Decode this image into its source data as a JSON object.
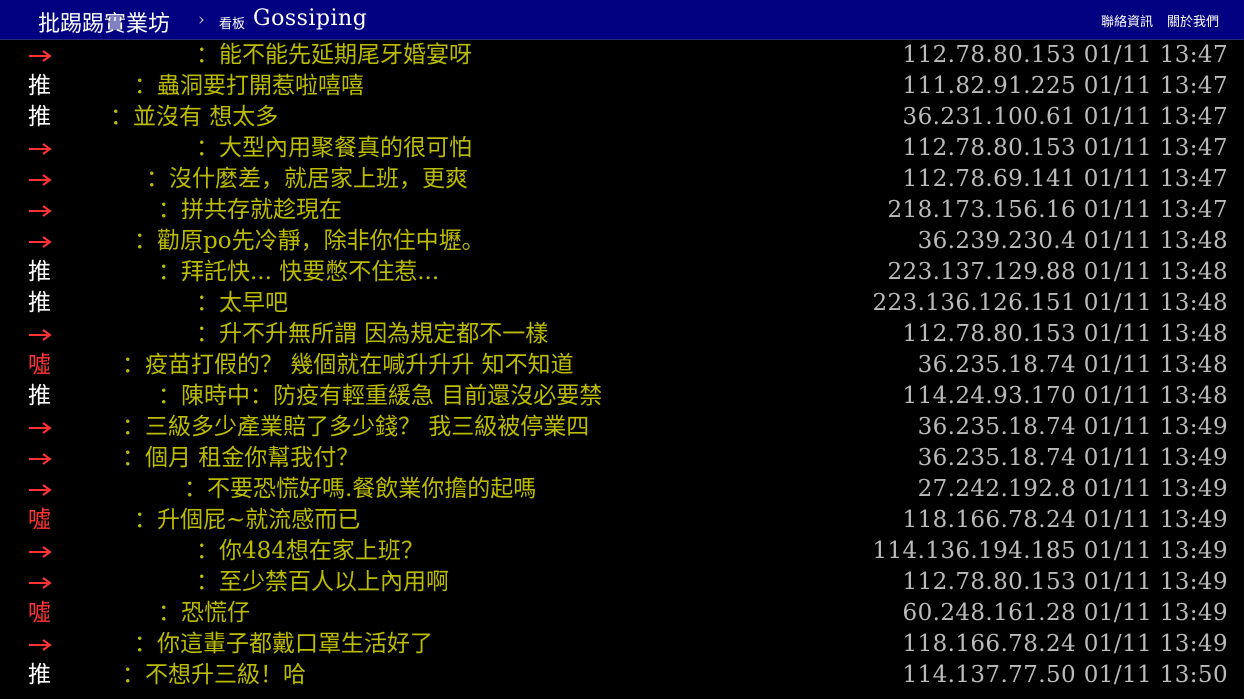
{
  "topbar": {
    "site_title": "批踢踢實業坊",
    "separator": "›",
    "board_label": "看板",
    "board_name": "Gossiping",
    "contact": "聯絡資訊",
    "about": "關於我們"
  },
  "pushes": [
    {
      "tag": "→",
      "type": "arrow",
      "content": "：能不能先延期尾牙婚宴呀",
      "ipdatetime": "112.78.80.153 01/11 13:47"
    },
    {
      "tag": "推",
      "type": "push",
      "content": "：蟲洞要打開惹啦嘻嘻",
      "ipdatetime": "111.82.91.225 01/11 13:47"
    },
    {
      "tag": "推",
      "type": "push",
      "content": "：並沒有 想太多",
      "ipdatetime": "36.231.100.61 01/11 13:47"
    },
    {
      "tag": "→",
      "type": "arrow",
      "content": "：大型內用聚餐真的很可怕",
      "ipdatetime": "112.78.80.153 01/11 13:47"
    },
    {
      "tag": "→",
      "type": "arrow",
      "content": "：沒什麼差，就居家上班，更爽",
      "ipdatetime": "112.78.69.141 01/11 13:47"
    },
    {
      "tag": "→",
      "type": "arrow",
      "content": "：拼共存就趁現在",
      "ipdatetime": "218.173.156.16 01/11 13:47"
    },
    {
      "tag": "→",
      "type": "arrow",
      "content": "：勸原po先冷靜，除非你住中壢。",
      "ipdatetime": "36.239.230.4 01/11 13:48"
    },
    {
      "tag": "推",
      "type": "push",
      "content": "：拜託快... 快要憋不住惹...",
      "ipdatetime": "223.137.129.88 01/11 13:48"
    },
    {
      "tag": "推",
      "type": "push",
      "content": "：太早吧",
      "ipdatetime": "223.136.126.151 01/11 13:48"
    },
    {
      "tag": "→",
      "type": "arrow",
      "content": "：升不升無所謂 因為規定都不一樣",
      "ipdatetime": "112.78.80.153 01/11 13:48"
    },
    {
      "tag": "噓",
      "type": "boo",
      "content": "：疫苗打假的？ 幾個就在喊升升升 知不知道",
      "ipdatetime": "36.235.18.74 01/11 13:48"
    },
    {
      "tag": "推",
      "type": "push",
      "content": "：陳時中：防疫有輕重緩急 目前還沒必要禁",
      "ipdatetime": "114.24.93.170 01/11 13:48"
    },
    {
      "tag": "→",
      "type": "arrow",
      "content": "：三級多少產業賠了多少錢？ 我三級被停業四",
      "ipdatetime": "36.235.18.74 01/11 13:49"
    },
    {
      "tag": "→",
      "type": "arrow",
      "content": "：個月 租金你幫我付？",
      "ipdatetime": "36.235.18.74 01/11 13:49"
    },
    {
      "tag": "→",
      "type": "arrow",
      "content": "：不要恐慌好嗎.餐飲業你擔的起嗎",
      "ipdatetime": "27.242.192.8 01/11 13:49"
    },
    {
      "tag": "噓",
      "type": "boo",
      "content": "：升個屁~就流感而已",
      "ipdatetime": "118.166.78.24 01/11 13:49"
    },
    {
      "tag": "→",
      "type": "arrow",
      "content": "：你484想在家上班？",
      "ipdatetime": "114.136.194.185 01/11 13:49"
    },
    {
      "tag": "→",
      "type": "arrow",
      "content": "：至少禁百人以上內用啊",
      "ipdatetime": "112.78.80.153 01/11 13:49"
    },
    {
      "tag": "噓",
      "type": "boo",
      "content": "：恐慌仔",
      "ipdatetime": "60.248.161.28 01/11 13:49"
    },
    {
      "tag": "→",
      "type": "arrow",
      "content": "：你這輩子都戴口罩生活好了",
      "ipdatetime": "118.166.78.24 01/11 13:49"
    },
    {
      "tag": "推",
      "type": "push",
      "content": "：不想升三級！哈",
      "ipdatetime": "114.137.77.50 01/11 13:50"
    }
  ]
}
